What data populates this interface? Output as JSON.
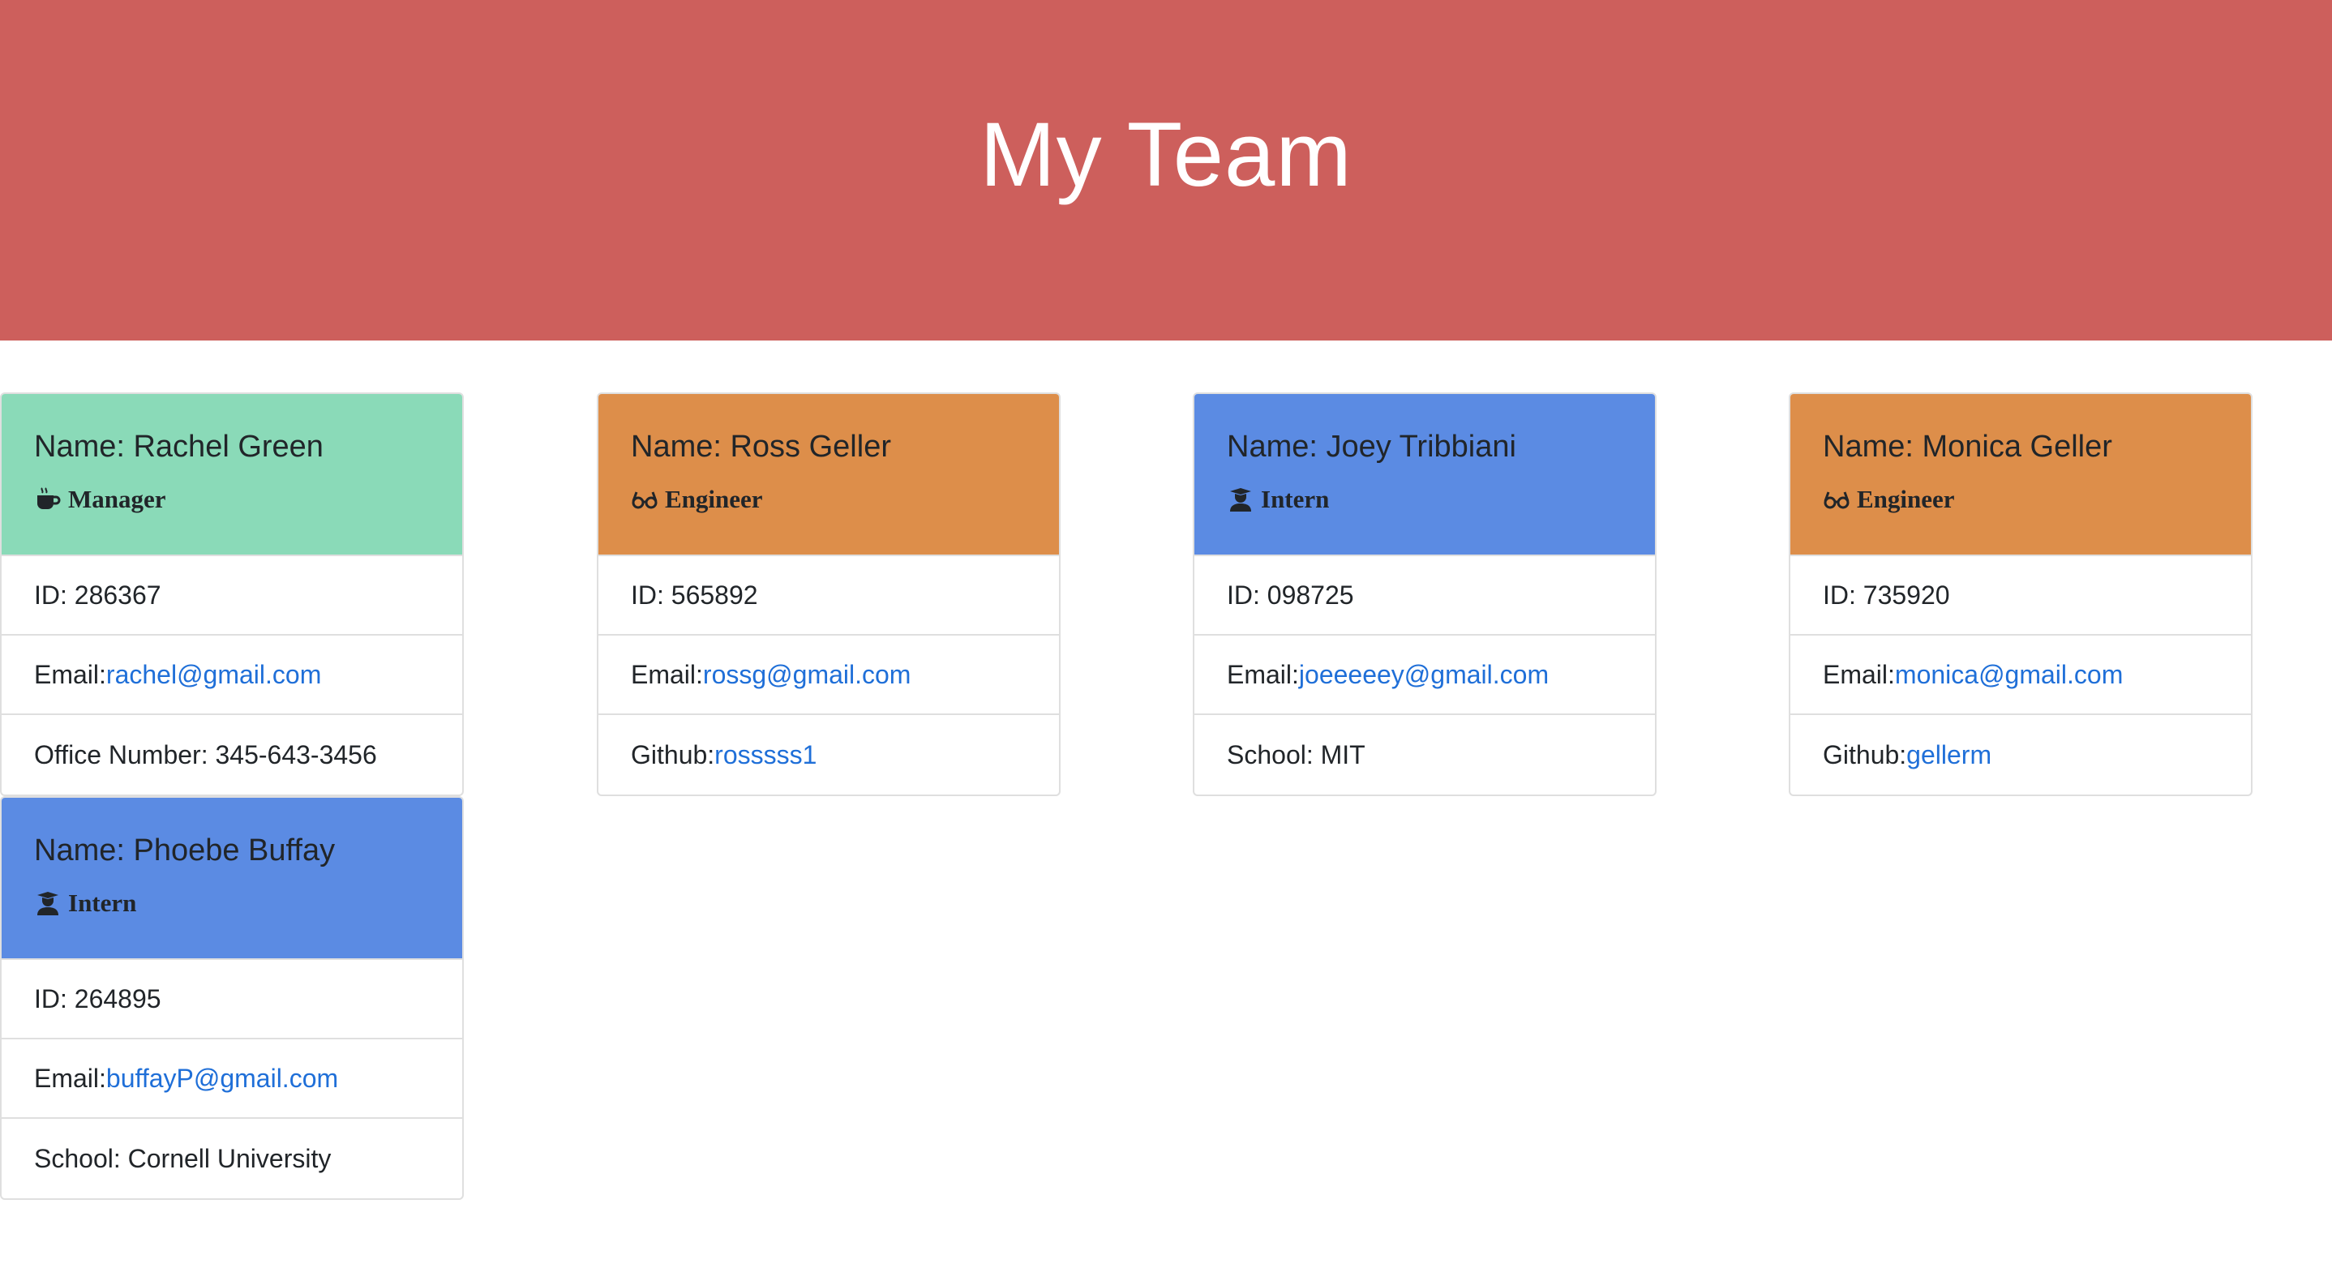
{
  "header": {
    "title": "My Team"
  },
  "colors": {
    "jumbotron": "#cd5f5c",
    "manager": "#8adab8",
    "engineer": "#dd8e4a",
    "intern": "#5b8be3",
    "link": "#1f6fd8"
  },
  "employees": [
    {
      "name": "Name: Rachel Green",
      "role": "Manager",
      "icon": "coffee-icon",
      "id": "ID: 286367",
      "email_label": "Email:",
      "email": "rachel@gmail.com",
      "extra_label": "Office Number: 345-643-3456",
      "extra_link": ""
    },
    {
      "name": "Name: Ross Geller",
      "role": "Engineer",
      "icon": "glasses-icon",
      "id": "ID: 565892",
      "email_label": "Email:",
      "email": "rossg@gmail.com",
      "extra_label": "Github:",
      "extra_link": "rosssss1"
    },
    {
      "name": "Name: Joey Tribbiani",
      "role": "Intern",
      "icon": "graduate-icon",
      "id": "ID: 098725",
      "email_label": "Email:",
      "email": "joeeeeey@gmail.com",
      "extra_label": "School: MIT",
      "extra_link": ""
    },
    {
      "name": "Name: Monica Geller",
      "role": "Engineer",
      "icon": "glasses-icon",
      "id": "ID: 735920",
      "email_label": "Email:",
      "email": "monica@gmail.com",
      "extra_label": "Github:",
      "extra_link": "gellerm"
    },
    {
      "name": "Name: Phoebe Buffay",
      "role": "Intern",
      "icon": "graduate-icon",
      "id": "ID: 264895",
      "email_label": "Email:",
      "email": "buffayP@gmail.com",
      "extra_label": "School: Cornell University",
      "extra_link": ""
    }
  ]
}
